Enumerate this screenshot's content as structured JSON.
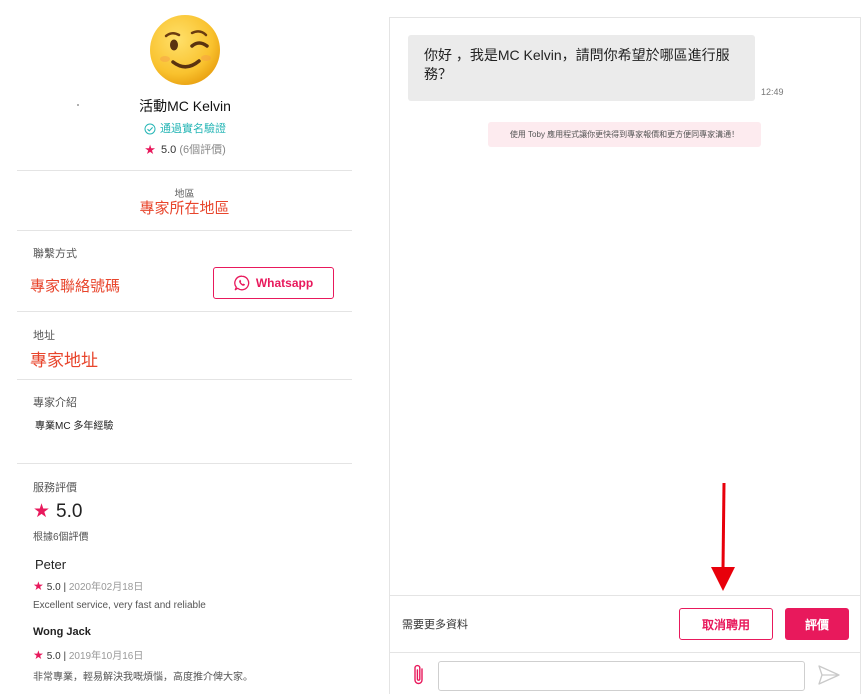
{
  "profile": {
    "avatar_icon": "winking-face-emoji",
    "name": "活動MC Kelvin",
    "verified_text": "通過實名驗證",
    "rating_value": "5.0",
    "rating_count": "(6個評價)"
  },
  "region": {
    "label": "地區",
    "value": "專家所在地區"
  },
  "contact": {
    "label": "聯繫方式",
    "value": "專家聯絡號碼",
    "whatsapp_label": "Whatsapp"
  },
  "address": {
    "label": "地址",
    "value": "專家地址"
  },
  "intro": {
    "label": "專家介紹",
    "value": "專業MC 多年經驗"
  },
  "reviews": {
    "label": "服務評價",
    "score": "5.0",
    "based_on": "根據6個評價",
    "items": [
      {
        "name": "Peter",
        "rating": "5.0",
        "separator": "|",
        "date": "2020年02月18日",
        "text": "Excellent service, very fast and reliable"
      },
      {
        "name": "Wong Jack",
        "rating": "5.0",
        "separator": "|",
        "date": "2019年10月16日",
        "text": "非常專業，輕易解決我嘅煩惱，高度推介俾大家。"
      }
    ]
  },
  "chat": {
    "message_text": "你好 ，我是MC Kelvin，請問你希望於哪區進行服務？",
    "message_time": "12:49",
    "notice": "使用 Toby 應用程式讓你更快得到專家報價和更方便同專家溝通！",
    "need_more_label": "需要更多資料",
    "cancel_hire_label": "取消聘用",
    "review_label": "評價",
    "input_placeholder": "",
    "attach_icon": "paperclip-icon",
    "send_icon": "send-icon"
  },
  "colors": {
    "accent": "#e8195c",
    "highlight_text": "#e8452c",
    "verified": "#26b6b6",
    "annotation_arrow": "#e8000b"
  }
}
